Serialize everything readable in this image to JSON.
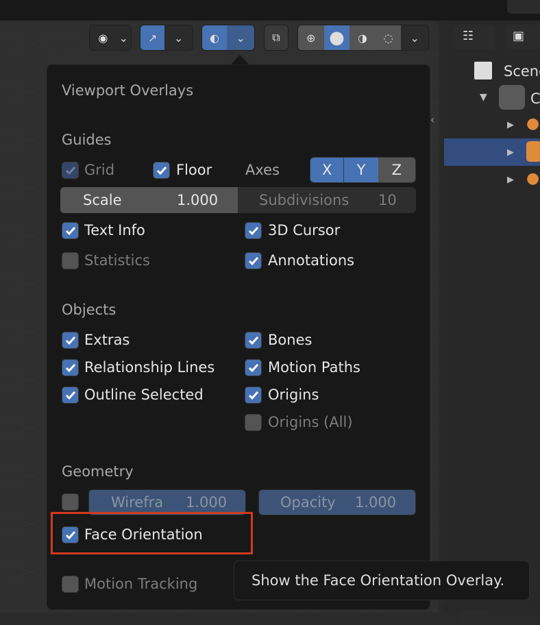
{
  "header": {
    "chevron": "⌄"
  },
  "outliner": {
    "scene_label": "Scene",
    "collection_label": "C"
  },
  "popup": {
    "title": "Viewport Overlays",
    "guides": {
      "heading": "Guides",
      "grid": "Grid",
      "floor": "Floor",
      "axes": "Axes",
      "axis_x": "X",
      "axis_y": "Y",
      "axis_z": "Z",
      "scale_label": "Scale",
      "scale_value": "1.000",
      "subdivisions_label": "Subdivisions",
      "subdivisions_value": "10",
      "text_info": "Text Info",
      "cursor_3d": "3D Cursor",
      "statistics": "Statistics",
      "annotations": "Annotations"
    },
    "objects": {
      "heading": "Objects",
      "extras": "Extras",
      "bones": "Bones",
      "relationship_lines": "Relationship Lines",
      "motion_paths": "Motion Paths",
      "outline_selected": "Outline Selected",
      "origins": "Origins",
      "origins_all": "Origins (All)"
    },
    "geometry": {
      "heading": "Geometry",
      "wireframe_label": "Wirefra",
      "wireframe_value": "1.000",
      "opacity_label": "Opacity",
      "opacity_value": "1.000",
      "face_orientation": "Face Orientation"
    },
    "motion_tracking": "Motion Tracking"
  },
  "tooltip": "Show the Face Orientation Overlay.",
  "colors": {
    "accent": "#4772b3",
    "highlight": "#d13a1e"
  }
}
